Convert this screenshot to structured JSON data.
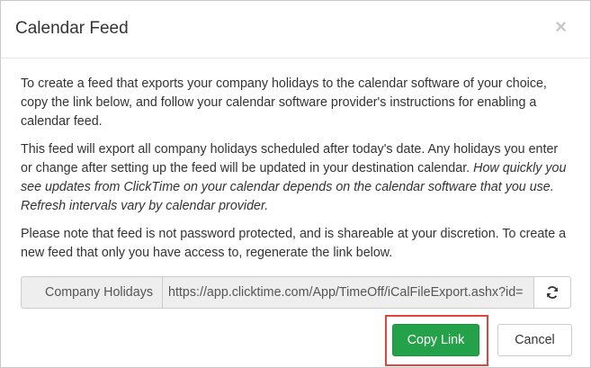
{
  "modal": {
    "title": "Calendar Feed",
    "close_symbol": "×"
  },
  "body": {
    "paragraph1": "To create a feed that exports your company holidays to the calendar software of your choice, copy the link below, and follow your calendar software provider's instructions for enabling a calendar feed.",
    "paragraph2_plain": "This feed will export all company holidays scheduled after today's date. Any holidays you enter or change after setting up the feed will be updated in your destination calendar. ",
    "paragraph2_italic": "How quickly you see updates from ClickTime on your calendar depends on the calendar software that you use. Refresh intervals vary by calendar provider.",
    "paragraph3": "Please note that feed is not password protected, and is shareable at your discretion. To create a new feed that only you have access to, regenerate the link below."
  },
  "feed": {
    "label": "Company Holidays",
    "url": "https://app.clicktime.com/App/TimeOff/iCalFileExport.ashx?id=",
    "refresh_icon": "refresh-icon"
  },
  "footer": {
    "copy_label": "Copy Link",
    "cancel_label": "Cancel"
  },
  "colors": {
    "primary_green": "#24a149",
    "highlight_red": "#e0463d"
  }
}
